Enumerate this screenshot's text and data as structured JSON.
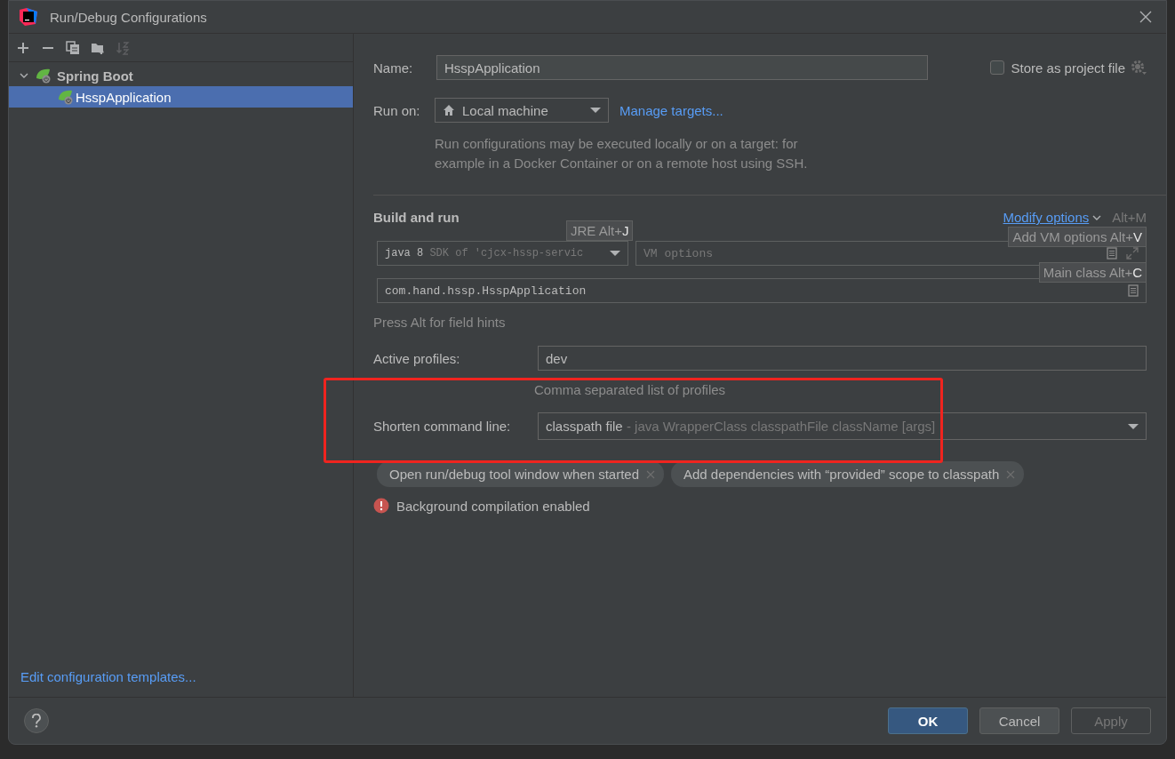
{
  "window": {
    "title": "Run/Debug Configurations"
  },
  "toolbar": [
    {
      "kind": "add",
      "disabled": false
    },
    {
      "kind": "remove",
      "disabled": false
    },
    {
      "kind": "copy",
      "disabled": false
    },
    {
      "kind": "folder",
      "disabled": false
    },
    {
      "kind": "sort",
      "disabled": true
    }
  ],
  "tree": [
    {
      "label": "Spring Boot",
      "expanded": true,
      "selected": false,
      "children": [
        {
          "label": "HsspApplication",
          "selected": true
        }
      ]
    }
  ],
  "templates_link": "Edit configuration templates...",
  "name": {
    "label": "Name:",
    "value": "HsspApplication"
  },
  "store_as_project_file": {
    "label": "Store as project file",
    "checked": false
  },
  "run_on": {
    "label": "Run on:",
    "value": "Local machine",
    "link": "Manage targets...",
    "hint": "Run configurations may be executed locally or on a target: for example in a Docker Container or on a remote host using SSH."
  },
  "build_and_run": {
    "title": "Build and run",
    "modify_options": "Modify options",
    "modify_shortcut": "Alt+M",
    "jre": {
      "value": "java 8",
      "detail": "SDK of 'cjcx-hssp-servic"
    },
    "vm_options": {
      "placeholder": "VM options"
    },
    "main_class": {
      "value": "com.hand.hssp.HsspApplication"
    },
    "field_hint": "Press Alt for field hints"
  },
  "tooltips": [
    {
      "kind": "jre",
      "text": "JRE Alt+",
      "key": "J"
    },
    {
      "kind": "vm",
      "text": "Add VM options Alt+",
      "key": "V"
    },
    {
      "kind": "main",
      "text": "Main class Alt+",
      "key": "C"
    }
  ],
  "active_profiles": {
    "label": "Active profiles:",
    "value": "dev",
    "hint": "Comma separated list of profiles"
  },
  "shorten_command_line": {
    "label": "Shorten command line:",
    "value": "classpath file",
    "detail": "- java WrapperClass classpathFile className [args]"
  },
  "option_chips": [
    {
      "label": "Open run/debug tool window when started"
    },
    {
      "label": "Add dependencies with “provided” scope to classpath"
    }
  ],
  "warning": "Background compilation enabled",
  "buttons": [
    {
      "label": "OK",
      "kind": "primary",
      "disabled": false
    },
    {
      "label": "Cancel",
      "kind": "default",
      "disabled": false
    },
    {
      "label": "Apply",
      "kind": "default",
      "disabled": true
    }
  ]
}
